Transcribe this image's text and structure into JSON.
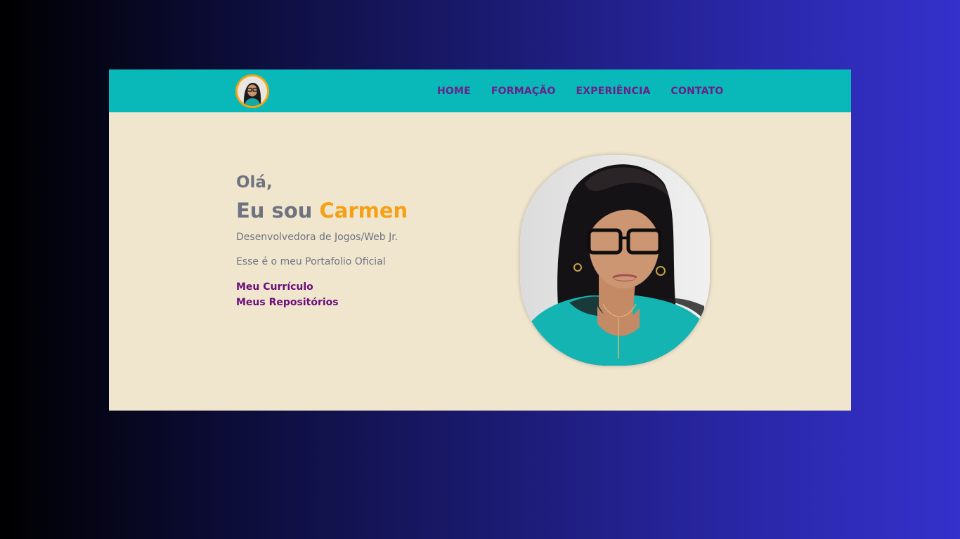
{
  "colors": {
    "navbar": "#09b8b8",
    "hero_background": "#f0e6ce",
    "nav_link": "#6b1f8a",
    "accent_name": "#f5a015",
    "link": "#6b0d7a",
    "muted_text": "#6f7380",
    "avatar_border": "#f5a511"
  },
  "navbar": {
    "avatar_icon": "profile-photo",
    "links": [
      "HOME",
      "FORMAÇÃO",
      "EXPERIÊNCIA",
      "CONTATO"
    ]
  },
  "hero": {
    "greeting": "Olá,",
    "intro_prefix": "Eu sou ",
    "name": "Carmen",
    "role": "Desenvolvedora de Jogos/Web Jr.",
    "tagline": "Esse é o meu Portafolio Oficial",
    "links": [
      "Meu Currículo",
      "Meus Repositórios"
    ],
    "portrait_icon": "profile-photo"
  }
}
